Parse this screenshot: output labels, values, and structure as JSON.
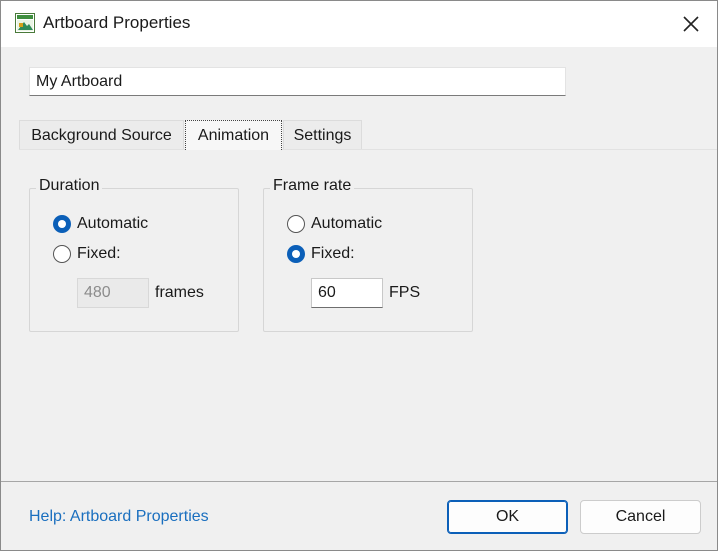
{
  "window": {
    "title": "Artboard Properties",
    "icon": "artboard-app-icon",
    "close_icon": "close-icon"
  },
  "name_field": {
    "value": "My Artboard"
  },
  "tabs": [
    {
      "label": "Background Source",
      "active": false
    },
    {
      "label": "Animation",
      "active": true
    },
    {
      "label": "Settings",
      "active": false
    }
  ],
  "duration": {
    "label": "Duration",
    "options": [
      {
        "label": "Automatic",
        "checked": true
      },
      {
        "label": "Fixed:",
        "checked": false
      }
    ],
    "value": "480",
    "value_enabled": false,
    "unit": "frames"
  },
  "frame_rate": {
    "label": "Frame rate",
    "options": [
      {
        "label": "Automatic",
        "checked": false
      },
      {
        "label": "Fixed:",
        "checked": true
      }
    ],
    "value": "60",
    "value_enabled": true,
    "unit": "FPS"
  },
  "footer": {
    "help_link": "Help: Artboard Properties",
    "ok_label": "OK",
    "cancel_label": "Cancel"
  },
  "colors": {
    "accent": "#0b5fb8",
    "link": "#1a6fbf",
    "dialog_bg": "#f0f0f0"
  }
}
